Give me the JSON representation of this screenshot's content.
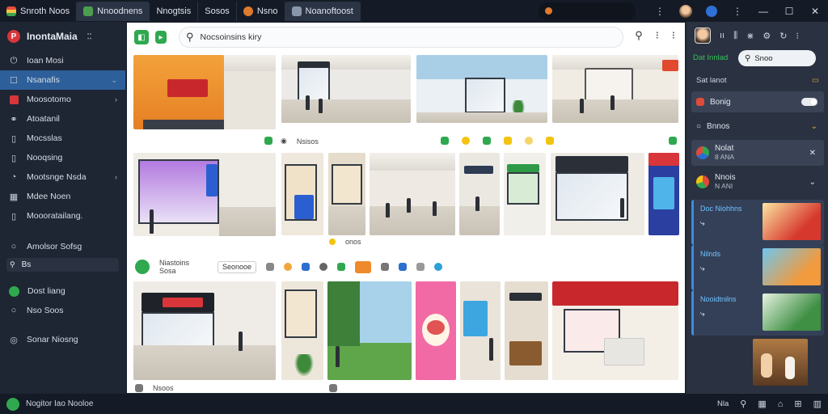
{
  "window": {
    "tabs": [
      {
        "label": "Snroth Noos"
      },
      {
        "label": "Nnoodnens"
      },
      {
        "label": "Nnogtsis"
      },
      {
        "label": "Sosos"
      },
      {
        "label": "Nsno"
      },
      {
        "label": "Noanoftoost"
      }
    ]
  },
  "sidebar": {
    "brand": "InontaMaia",
    "items": [
      {
        "label": "Ioan Mosi",
        "icon": "power-icon"
      },
      {
        "label": "Nsanafis",
        "icon": "square-icon"
      },
      {
        "label": "Moosotomo",
        "icon": "red-square-icon"
      },
      {
        "label": "Atoatanil",
        "icon": "nodes-icon"
      },
      {
        "label": "Mocsslas",
        "icon": "document-icon"
      },
      {
        "label": "Nooqsing",
        "icon": "document-icon"
      },
      {
        "label": "Mootsnge Nsda",
        "icon": "user-circle-icon"
      },
      {
        "label": "Mdee Noen",
        "icon": "grid-icon"
      },
      {
        "label": "Moooratailang.",
        "icon": "document-icon"
      }
    ],
    "section_label": "Amolsor Sofsg",
    "search_label": "Bs",
    "bottom_items": [
      {
        "label": "Dost liang"
      },
      {
        "label": "Nso Soos"
      },
      {
        "label": "Sonar Niosng"
      }
    ]
  },
  "content": {
    "search_placeholder": "Nocsoinsins kiry",
    "row1_label": "Nsisos",
    "row2_label": "onos",
    "row3_label": "Niastoins Sosa",
    "row3_filter": "Seonooe",
    "row4_label": "Nsoos"
  },
  "rightpanel": {
    "green_label": "Dat Innlad",
    "search_text": "Snoo",
    "section1": "Sat lanot",
    "item_toggle": "Bonig",
    "item_dropdown": "Bnnos",
    "item_a": {
      "title": "Nolat",
      "sub": "8 ANA"
    },
    "item_b": {
      "title": "Nnois",
      "sub": "N ANI"
    },
    "promos": [
      {
        "title": "Doc Niohhns"
      },
      {
        "title": "Nilnds"
      },
      {
        "title": "Nooidtnilns"
      }
    ]
  },
  "statusbar": {
    "text": "Nogitor Iao Nooloe",
    "right_label": "Nla"
  },
  "colors": {
    "accent_blue": "#2d5f9a",
    "green": "#2fa84f",
    "red": "#d8363a"
  }
}
